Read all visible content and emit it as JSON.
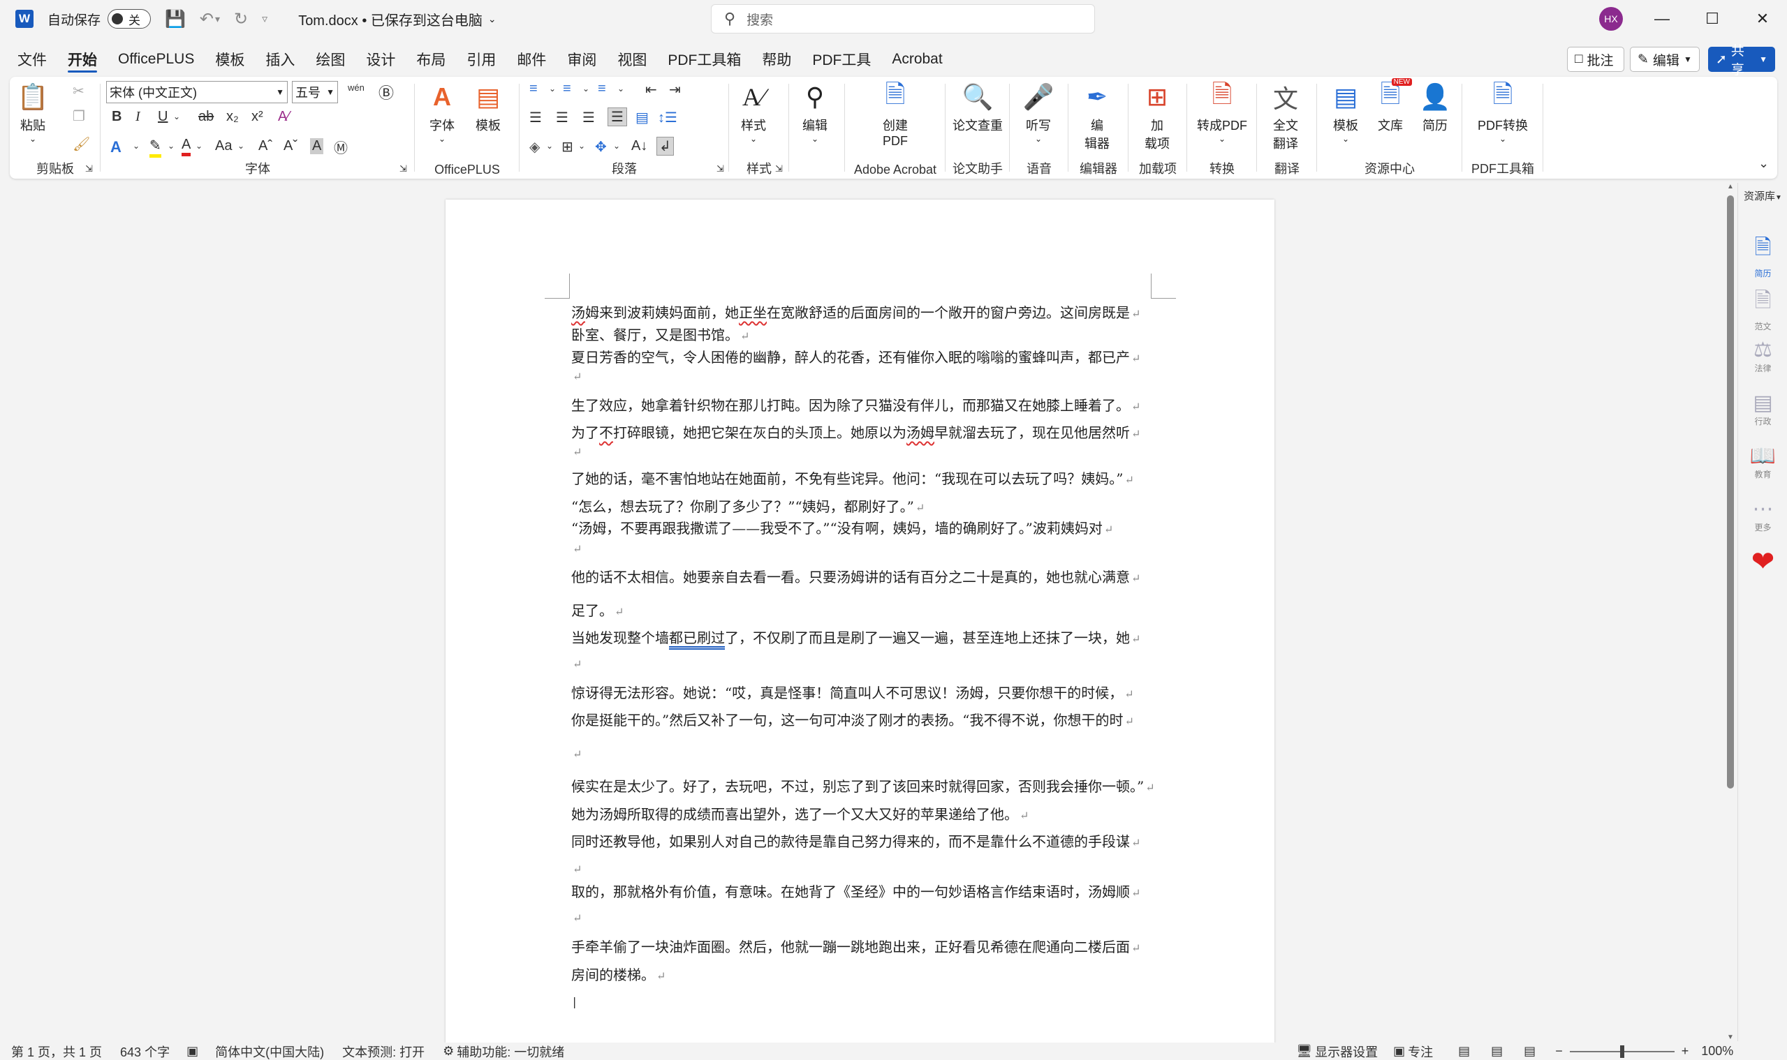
{
  "titlebar": {
    "autosave_label": "自动保存",
    "autosave_state": "关",
    "doc_title": "Tom.docx • 已保存到这台电脑",
    "search_placeholder": "搜索",
    "avatar_initials": "HX"
  },
  "menu": {
    "tabs": [
      "文件",
      "开始",
      "OfficePLUS",
      "模板",
      "插入",
      "绘图",
      "设计",
      "布局",
      "引用",
      "邮件",
      "审阅",
      "视图",
      "PDF工具箱",
      "帮助",
      "PDF工具",
      "Acrobat"
    ],
    "active_tab": "开始",
    "comment_btn": "批注",
    "edit_btn": "编辑",
    "share_btn": "共享"
  },
  "ribbon": {
    "paste": "粘贴",
    "clipboard_group": "剪贴板",
    "font_name": "宋体 (中文正文)",
    "font_size": "五号",
    "font_group": "字体",
    "font_btn": "字体",
    "template_btn": "模板",
    "officeplus_group": "OfficePLUS",
    "paragraph_group": "段落",
    "styles_btn": "样式",
    "styles_group": "样式",
    "editing_btn": "编辑",
    "create_pdf_btn": "创建\nPDF",
    "adobe_group": "Adobe Acrobat",
    "paper_check_btn": "论文查重",
    "paper_group": "论文助手",
    "dictate_btn": "听写",
    "voice_group": "语音",
    "editor_btn": "编\n辑器",
    "editor_group": "编辑器",
    "addins_btn": "加\n载项",
    "addins_group": "加载项",
    "to_pdf_btn": "转成PDF",
    "convert_group": "转换",
    "translate_btn": "全文\n翻译",
    "translate_group": "翻译",
    "templates2_btn": "模板",
    "library_btn": "文库",
    "library_badge": "NEW",
    "resume_btn": "简历",
    "resource_group": "资源中心",
    "pdf_convert_btn": "PDF转换",
    "pdftool_group": "PDF工具箱"
  },
  "document": {
    "lines": [
      [
        "汤",
        "姆",
        "来到波莉姨妈面前，她",
        "正坐",
        "在宽敞舒适的后面房间的一个敞开的窗户旁边。这间房既是"
      ],
      [
        "卧室、餐厅，又是图书馆。"
      ],
      [
        "夏日芳香的空气，令人困倦的幽静，醉人的花香，还有催你入眠的嗡嗡的蜜蜂叫声，都已产"
      ],
      [
        ""
      ],
      [
        "生了效应，她拿着针织物在那儿打盹。因为除了只猫没有伴儿，而那猫又在她膝上睡着了。"
      ],
      [
        "为了",
        "不",
        "打碎眼镜，她把它架在灰白的头顶上。她原以为",
        "汤姆",
        "早就溜去玩了，现在见他居然听"
      ],
      [
        ""
      ],
      [
        "了她的话，毫不害怕地站在她面前，不免有些诧异。他问：“我现在可以去玩了吗？姨妈。”"
      ],
      [
        "“怎么，想去玩了？你刷了多少了？”“姨妈，都刷好了。”"
      ],
      [
        "“汤姆，不要再跟我撒谎了——我受不了。”“没有啊，姨妈，墙的确刷好了。”波莉姨妈对"
      ],
      [
        ""
      ],
      [
        "他的话不太相信。她要亲自去看一看。只要汤姆讲的话有百分之二十是真的，她也就心满意"
      ],
      [
        "足了。"
      ],
      [
        "当她发现整个墙",
        "都已刷过",
        "了，不仅刷了而且是刷了一遍又一遍，甚至连地上还抹了一块，她"
      ],
      [
        ""
      ],
      [
        "惊讶得无法形容。她说：“哎，真是怪事！简直叫人不可思议！汤姆，只要你想干的时候，"
      ],
      [
        "你是挺能干的。”然后又补了一句，这一句可冲淡了刚才的表扬。“我不得不说，你想干的时"
      ],
      [
        ""
      ],
      [
        "候实在是太少了。好了，去玩吧，不过，别忘了到了该回来时就得回家，否则我会捶你一顿。”"
      ],
      [
        "她为汤姆所取得的成绩而喜出望外，选了一个又大又好的苹果递给了他。"
      ],
      [
        "同时还教导他，如果别人对自己的款待是靠自己努力得来的，而不是靠什么不道德的手段谋"
      ],
      [
        ""
      ],
      [
        "取的，那就格外有价值，有意味。在她背了《圣经》中的一句妙语格言作结束语时，汤姆顺"
      ],
      [
        ""
      ],
      [
        "手牵羊偷了一块油炸面圈。然后，他就一蹦一跳地跑出来，正好看见希德在爬通向二楼后面"
      ],
      [
        "房间的楼梯。"
      ],
      [
        ""
      ]
    ]
  },
  "sidepanel": {
    "title": "资源库",
    "items": [
      "简历",
      "范文",
      "法律",
      "行政",
      "教育",
      "更多"
    ]
  },
  "statusbar": {
    "page": "第 1 页，共 1 页",
    "words": "643 个字",
    "language": "简体中文(中国大陆)",
    "text_predict": "文本预测: 打开",
    "accessibility": "辅助功能: 一切就绪",
    "display_settings": "显示器设置",
    "focus": "专注",
    "zoom": "100%"
  }
}
